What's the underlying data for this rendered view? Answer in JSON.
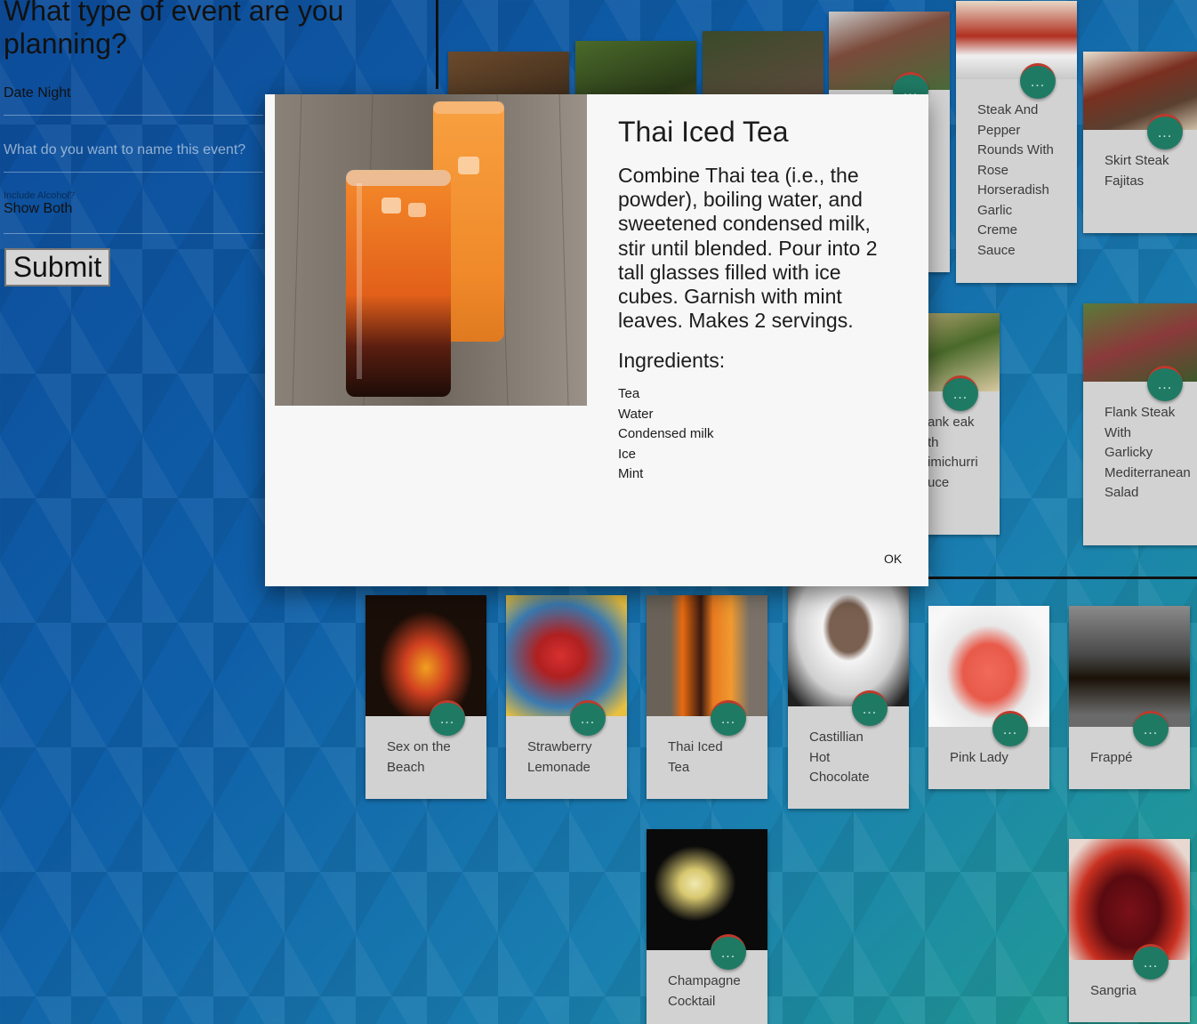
{
  "form": {
    "heading": "What type of event are you planning?",
    "event_type_value": "Date Night",
    "event_name_placeholder": "What do you want to name this event?",
    "alcohol_label": "Include Alcohol?",
    "alcohol_value": "Show Both",
    "submit_label": "Submit"
  },
  "food_cards": [
    {
      "title": ""
    },
    {
      "title": ""
    },
    {
      "title": ""
    },
    {
      "title": ""
    },
    {
      "title": "Steak And Pepper Rounds With Rose Horseradish Garlic Creme Sauce"
    },
    {
      "title": "Skirt Steak Fajitas"
    },
    {
      "title": "ank eak th imichurri uce"
    },
    {
      "title": "Flank Steak With Garlicky Mediterranean Salad"
    }
  ],
  "drink_cards": [
    {
      "title": "Sex on the Beach"
    },
    {
      "title": "Strawberry Lemonade"
    },
    {
      "title": "Thai Iced Tea"
    },
    {
      "title": "Castillian Hot Chocolate"
    },
    {
      "title": "Pink Lady"
    },
    {
      "title": "Frappé"
    },
    {
      "title": "Champagne Cocktail"
    },
    {
      "title": "Sangria"
    }
  ],
  "fab_label": "...",
  "modal": {
    "title": "Thai Iced Tea",
    "description": "Combine Thai tea (i.e., the powder), boiling water, and sweetened condensed milk, stir until blended. Pour into 2 tall glasses filled with ice cubes. Garnish with mint leaves. Makes 2 servings.",
    "ingredients_heading": "Ingredients:",
    "ingredients": [
      "Tea",
      "Water",
      "Condensed milk",
      "Ice",
      "Mint"
    ],
    "ok_label": "OK"
  },
  "colors": {
    "fab": "#1f7a64",
    "card": "#d2d2d2",
    "modal_bg": "#f7f7f7"
  }
}
